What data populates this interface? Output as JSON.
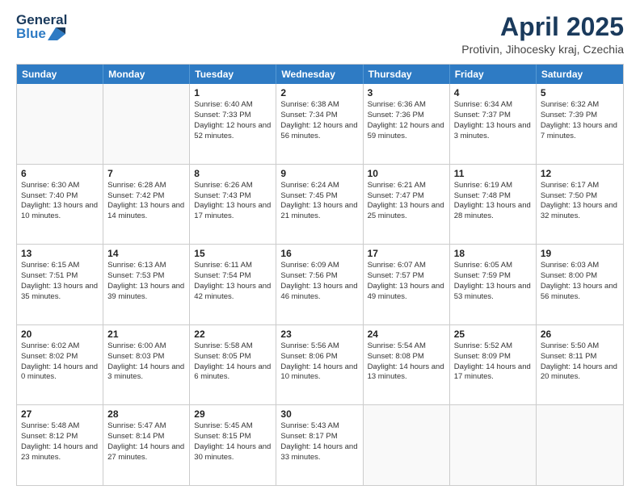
{
  "header": {
    "logo": {
      "general": "General",
      "blue": "Blue"
    },
    "title": "April 2025",
    "location": "Protivin, Jihocesky kraj, Czechia"
  },
  "weekdays": [
    "Sunday",
    "Monday",
    "Tuesday",
    "Wednesday",
    "Thursday",
    "Friday",
    "Saturday"
  ],
  "weeks": [
    [
      {
        "day": "",
        "sunrise": "",
        "sunset": "",
        "daylight": ""
      },
      {
        "day": "",
        "sunrise": "",
        "sunset": "",
        "daylight": ""
      },
      {
        "day": "1",
        "sunrise": "Sunrise: 6:40 AM",
        "sunset": "Sunset: 7:33 PM",
        "daylight": "Daylight: 12 hours and 52 minutes."
      },
      {
        "day": "2",
        "sunrise": "Sunrise: 6:38 AM",
        "sunset": "Sunset: 7:34 PM",
        "daylight": "Daylight: 12 hours and 56 minutes."
      },
      {
        "day": "3",
        "sunrise": "Sunrise: 6:36 AM",
        "sunset": "Sunset: 7:36 PM",
        "daylight": "Daylight: 12 hours and 59 minutes."
      },
      {
        "day": "4",
        "sunrise": "Sunrise: 6:34 AM",
        "sunset": "Sunset: 7:37 PM",
        "daylight": "Daylight: 13 hours and 3 minutes."
      },
      {
        "day": "5",
        "sunrise": "Sunrise: 6:32 AM",
        "sunset": "Sunset: 7:39 PM",
        "daylight": "Daylight: 13 hours and 7 minutes."
      }
    ],
    [
      {
        "day": "6",
        "sunrise": "Sunrise: 6:30 AM",
        "sunset": "Sunset: 7:40 PM",
        "daylight": "Daylight: 13 hours and 10 minutes."
      },
      {
        "day": "7",
        "sunrise": "Sunrise: 6:28 AM",
        "sunset": "Sunset: 7:42 PM",
        "daylight": "Daylight: 13 hours and 14 minutes."
      },
      {
        "day": "8",
        "sunrise": "Sunrise: 6:26 AM",
        "sunset": "Sunset: 7:43 PM",
        "daylight": "Daylight: 13 hours and 17 minutes."
      },
      {
        "day": "9",
        "sunrise": "Sunrise: 6:24 AM",
        "sunset": "Sunset: 7:45 PM",
        "daylight": "Daylight: 13 hours and 21 minutes."
      },
      {
        "day": "10",
        "sunrise": "Sunrise: 6:21 AM",
        "sunset": "Sunset: 7:47 PM",
        "daylight": "Daylight: 13 hours and 25 minutes."
      },
      {
        "day": "11",
        "sunrise": "Sunrise: 6:19 AM",
        "sunset": "Sunset: 7:48 PM",
        "daylight": "Daylight: 13 hours and 28 minutes."
      },
      {
        "day": "12",
        "sunrise": "Sunrise: 6:17 AM",
        "sunset": "Sunset: 7:50 PM",
        "daylight": "Daylight: 13 hours and 32 minutes."
      }
    ],
    [
      {
        "day": "13",
        "sunrise": "Sunrise: 6:15 AM",
        "sunset": "Sunset: 7:51 PM",
        "daylight": "Daylight: 13 hours and 35 minutes."
      },
      {
        "day": "14",
        "sunrise": "Sunrise: 6:13 AM",
        "sunset": "Sunset: 7:53 PM",
        "daylight": "Daylight: 13 hours and 39 minutes."
      },
      {
        "day": "15",
        "sunrise": "Sunrise: 6:11 AM",
        "sunset": "Sunset: 7:54 PM",
        "daylight": "Daylight: 13 hours and 42 minutes."
      },
      {
        "day": "16",
        "sunrise": "Sunrise: 6:09 AM",
        "sunset": "Sunset: 7:56 PM",
        "daylight": "Daylight: 13 hours and 46 minutes."
      },
      {
        "day": "17",
        "sunrise": "Sunrise: 6:07 AM",
        "sunset": "Sunset: 7:57 PM",
        "daylight": "Daylight: 13 hours and 49 minutes."
      },
      {
        "day": "18",
        "sunrise": "Sunrise: 6:05 AM",
        "sunset": "Sunset: 7:59 PM",
        "daylight": "Daylight: 13 hours and 53 minutes."
      },
      {
        "day": "19",
        "sunrise": "Sunrise: 6:03 AM",
        "sunset": "Sunset: 8:00 PM",
        "daylight": "Daylight: 13 hours and 56 minutes."
      }
    ],
    [
      {
        "day": "20",
        "sunrise": "Sunrise: 6:02 AM",
        "sunset": "Sunset: 8:02 PM",
        "daylight": "Daylight: 14 hours and 0 minutes."
      },
      {
        "day": "21",
        "sunrise": "Sunrise: 6:00 AM",
        "sunset": "Sunset: 8:03 PM",
        "daylight": "Daylight: 14 hours and 3 minutes."
      },
      {
        "day": "22",
        "sunrise": "Sunrise: 5:58 AM",
        "sunset": "Sunset: 8:05 PM",
        "daylight": "Daylight: 14 hours and 6 minutes."
      },
      {
        "day": "23",
        "sunrise": "Sunrise: 5:56 AM",
        "sunset": "Sunset: 8:06 PM",
        "daylight": "Daylight: 14 hours and 10 minutes."
      },
      {
        "day": "24",
        "sunrise": "Sunrise: 5:54 AM",
        "sunset": "Sunset: 8:08 PM",
        "daylight": "Daylight: 14 hours and 13 minutes."
      },
      {
        "day": "25",
        "sunrise": "Sunrise: 5:52 AM",
        "sunset": "Sunset: 8:09 PM",
        "daylight": "Daylight: 14 hours and 17 minutes."
      },
      {
        "day": "26",
        "sunrise": "Sunrise: 5:50 AM",
        "sunset": "Sunset: 8:11 PM",
        "daylight": "Daylight: 14 hours and 20 minutes."
      }
    ],
    [
      {
        "day": "27",
        "sunrise": "Sunrise: 5:48 AM",
        "sunset": "Sunset: 8:12 PM",
        "daylight": "Daylight: 14 hours and 23 minutes."
      },
      {
        "day": "28",
        "sunrise": "Sunrise: 5:47 AM",
        "sunset": "Sunset: 8:14 PM",
        "daylight": "Daylight: 14 hours and 27 minutes."
      },
      {
        "day": "29",
        "sunrise": "Sunrise: 5:45 AM",
        "sunset": "Sunset: 8:15 PM",
        "daylight": "Daylight: 14 hours and 30 minutes."
      },
      {
        "day": "30",
        "sunrise": "Sunrise: 5:43 AM",
        "sunset": "Sunset: 8:17 PM",
        "daylight": "Daylight: 14 hours and 33 minutes."
      },
      {
        "day": "",
        "sunrise": "",
        "sunset": "",
        "daylight": ""
      },
      {
        "day": "",
        "sunrise": "",
        "sunset": "",
        "daylight": ""
      },
      {
        "day": "",
        "sunrise": "",
        "sunset": "",
        "daylight": ""
      }
    ]
  ]
}
